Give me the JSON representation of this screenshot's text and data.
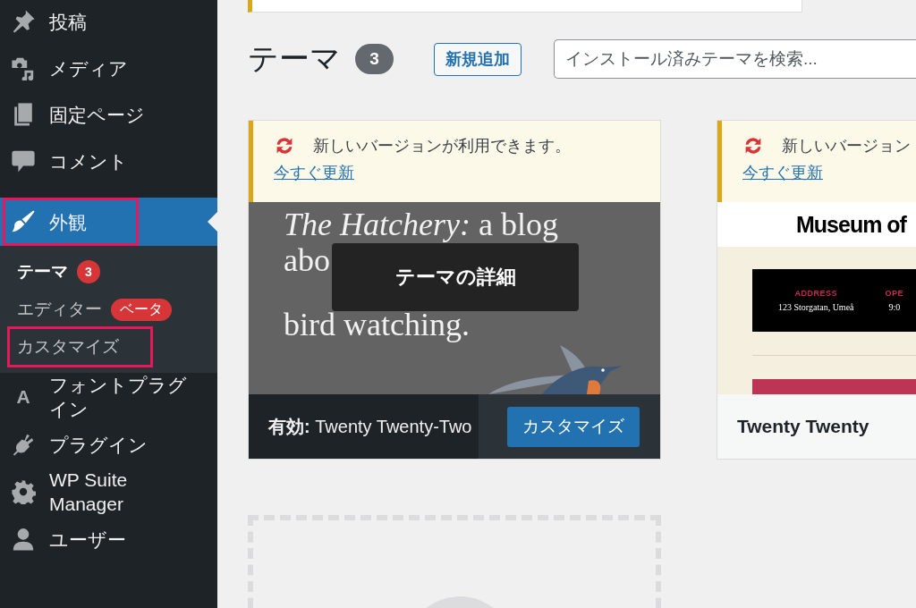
{
  "sidebar": {
    "items": [
      {
        "kind": "pin",
        "label": "投稿",
        "selected": false,
        "highlighted": false
      },
      {
        "kind": "media",
        "label": "メディア",
        "selected": false,
        "highlighted": false
      },
      {
        "kind": "pages",
        "label": "固定ページ",
        "selected": false,
        "highlighted": false
      },
      {
        "kind": "comment",
        "label": "コメント",
        "selected": false,
        "highlighted": false
      },
      {
        "kind": "brush",
        "label": "外観",
        "selected": true,
        "highlighted": true,
        "submenu": [
          {
            "label": "テーマ",
            "count": "3",
            "selected": true,
            "highlighted": false
          },
          {
            "label": "エディター",
            "tag": "ベータ",
            "selected": false,
            "highlighted": false
          },
          {
            "label": "カスタマイズ",
            "selected": false,
            "highlighted": true
          }
        ]
      },
      {
        "kind": "letter",
        "glyph": "A",
        "label": "フォントプラグイン",
        "selected": false,
        "highlighted": false
      },
      {
        "kind": "plug",
        "label": "プラグイン",
        "selected": false,
        "highlighted": false
      },
      {
        "kind": "gear",
        "label": "WP Suite Manager",
        "selected": false,
        "highlighted": false
      },
      {
        "kind": "user",
        "label": "ユーザー",
        "selected": false,
        "highlighted": false
      }
    ]
  },
  "header": {
    "title": "テーマ",
    "count": "3",
    "add_button": "新規追加",
    "search": {
      "placeholder": "インストール済みテーマを検索..."
    }
  },
  "themes": [
    {
      "kind": "active",
      "notice": "新しいバージョンが利用できます。",
      "update_link": "今すぐ更新",
      "preview": {
        "kind": "hatchery",
        "headline_lines": [
          [
            "*The Hatchery:* a blog"
          ],
          [
            "abo"
          ],
          [
            "bird watching."
          ]
        ],
        "overlay_button": "テーマの詳細"
      },
      "name": "**有効:** Twenty Twenty-Two",
      "customize_button": "カスタマイズ"
    },
    {
      "kind": "inactive",
      "notice": "新しいバージョン",
      "update_link": "今すぐ更新",
      "preview": {
        "kind": "museum",
        "title": "Museum of",
        "label_1": "ADDRESS",
        "address": "123 Storgatan, Umeå",
        "label_2": "OPE",
        "hours": "9:0"
      },
      "name": "Twenty Twenty"
    }
  ],
  "add_new_card": true
}
